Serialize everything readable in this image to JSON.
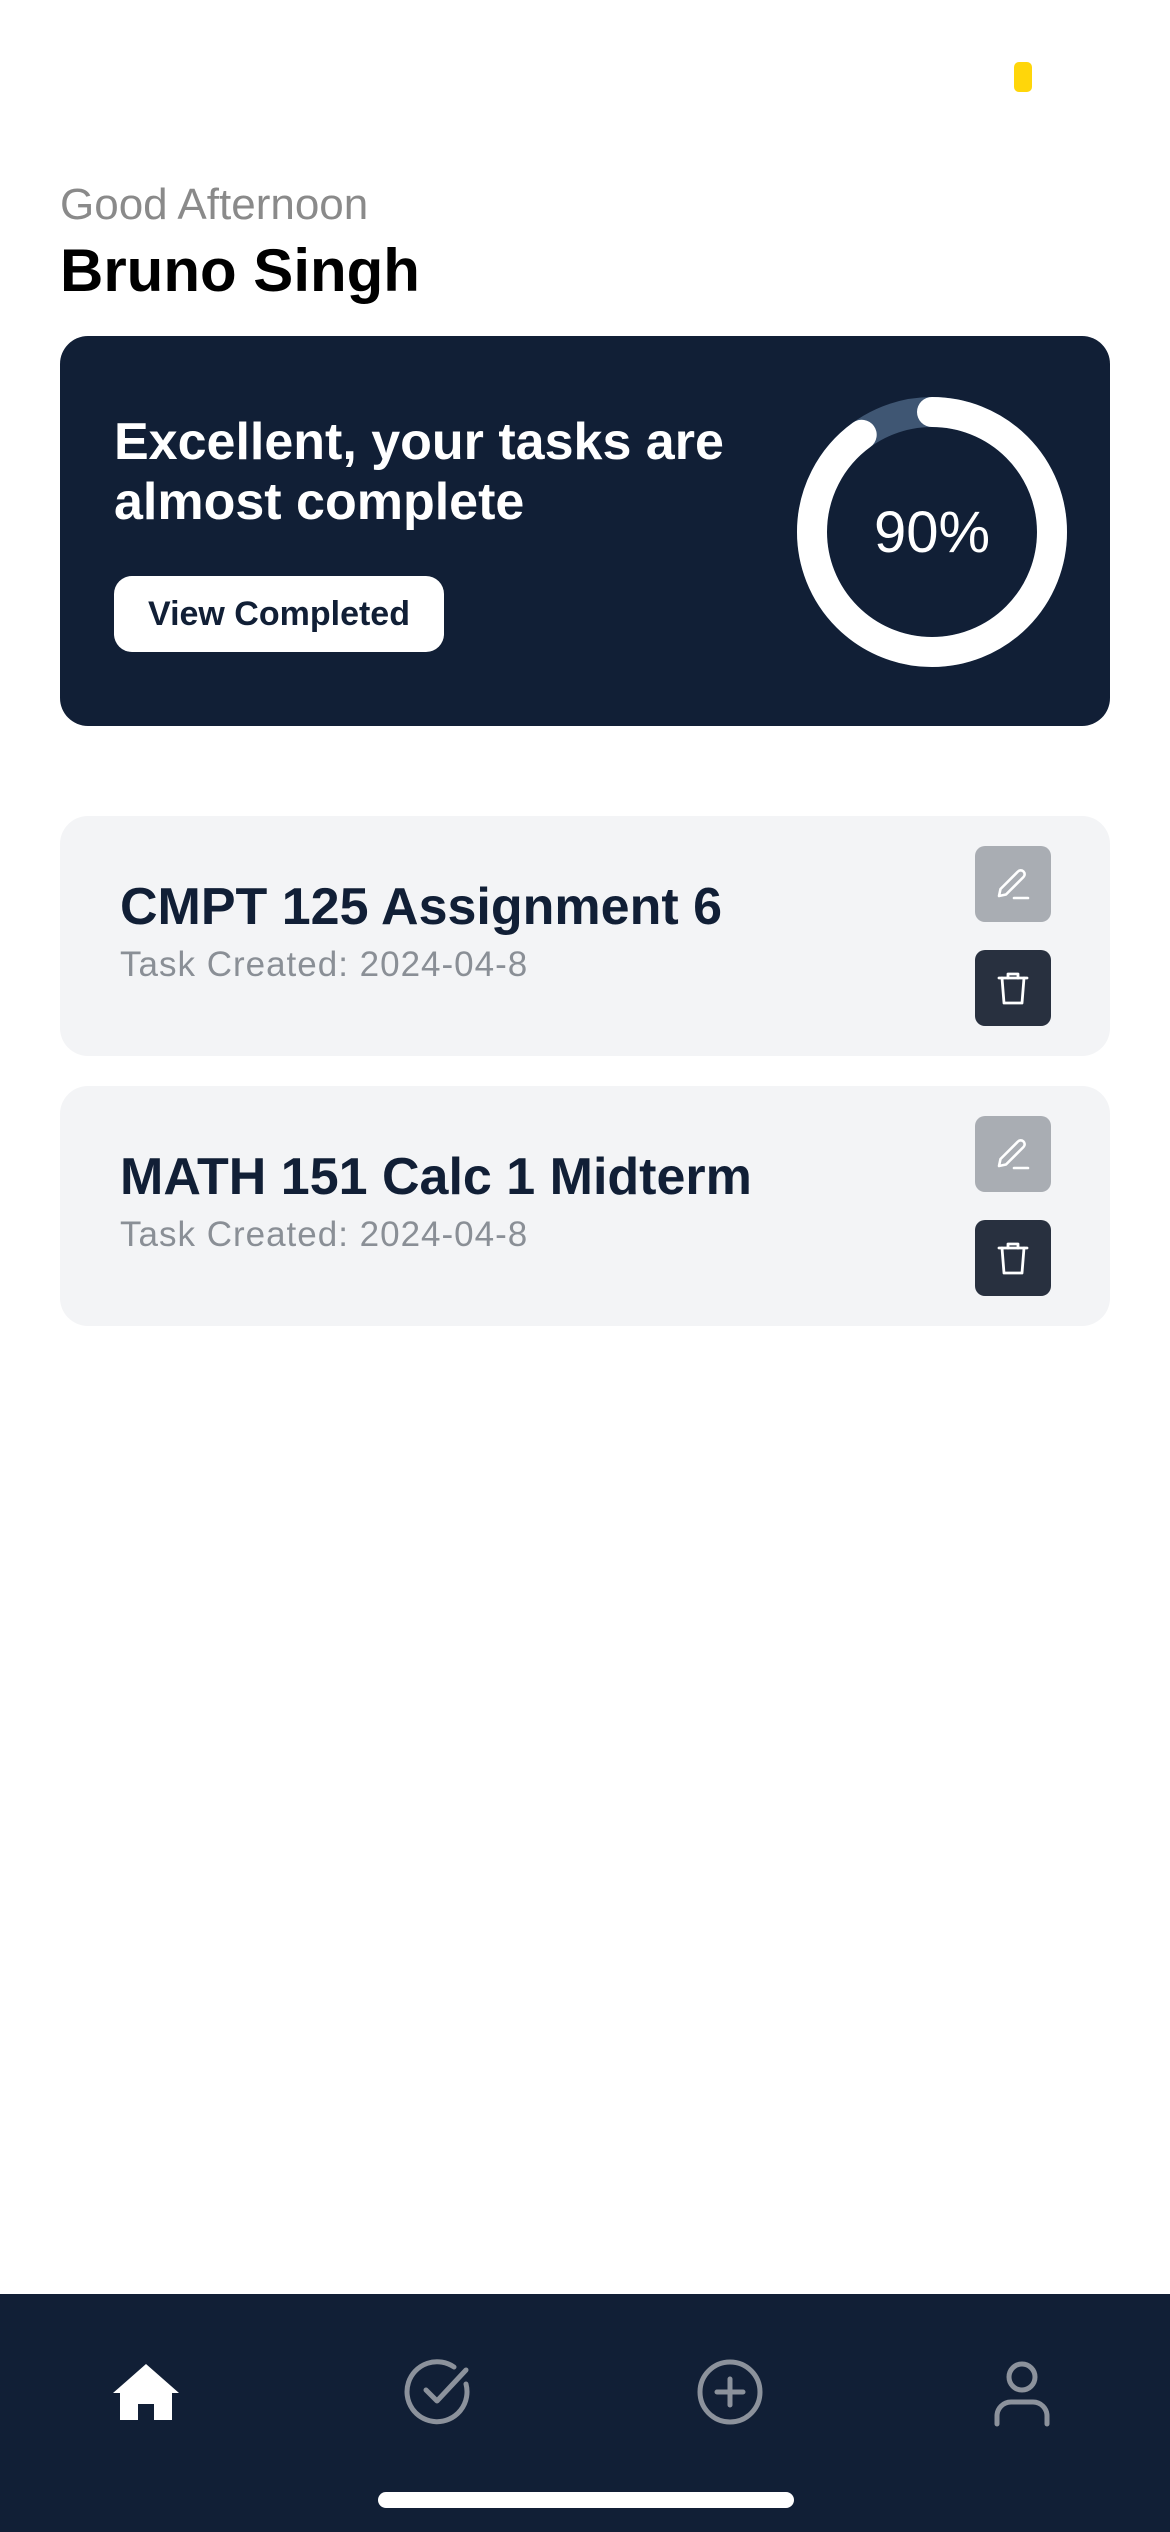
{
  "header": {
    "greeting": "Good Afternoon",
    "user_name": "Bruno Singh"
  },
  "progress_card": {
    "message": "Excellent, your tasks are almost complete",
    "button_label": "View Completed",
    "percent_label": "90%",
    "progress_fraction": 0.9
  },
  "tasks": [
    {
      "title": "CMPT 125 Assignment 6",
      "created": "Task Created: 2024-04-8"
    },
    {
      "title": "MATH 151 Calc 1 Midterm",
      "created": "Task Created: 2024-04-8"
    }
  ],
  "task_actions": {
    "edit_icon": "pencil-icon",
    "delete_icon": "trash-icon"
  },
  "bottom_nav": {
    "items": [
      {
        "name": "home",
        "icon": "home-icon",
        "active": true
      },
      {
        "name": "completed",
        "icon": "check-circle-icon",
        "active": false
      },
      {
        "name": "add",
        "icon": "plus-circle-icon",
        "active": false
      },
      {
        "name": "profile",
        "icon": "user-icon",
        "active": false
      }
    ]
  },
  "colors": {
    "navy": "#111f36",
    "ring_track": "#3f5673",
    "ring_fill": "#ffffff",
    "task_card_bg": "#f3f4f6",
    "task_title": "#111f36",
    "status_dot": "#ffd60a",
    "nav_inactive": "#8c929c"
  }
}
